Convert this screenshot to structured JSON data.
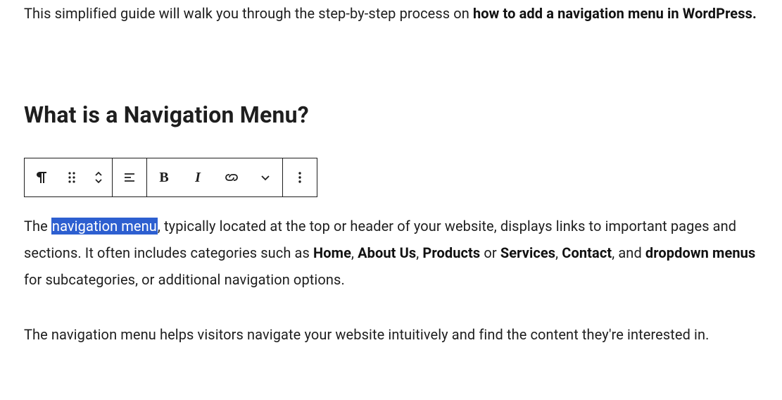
{
  "intro": {
    "prefix": "This simplified guide will walk you through the step-by-step process on ",
    "bold": "how to add a navigation menu in WordPress.",
    "suffix": ""
  },
  "heading": "What is a Navigation Menu?",
  "toolbar_icons": {
    "paragraph": "paragraph-icon",
    "drag": "drag-icon",
    "move": "move-updown-icon",
    "align": "align-left-icon",
    "bold": "B",
    "italic": "I",
    "link": "link-icon",
    "dropdown": "chevron-down-icon",
    "more": "more-vertical-icon"
  },
  "para1": {
    "t1": "The ",
    "highlight": "navigation menu",
    "t2": ", typically located at the top or header of your website, displays links to important pages and sections. It often includes categories such as ",
    "b1": "Home",
    "t3": ", ",
    "b2": "About Us",
    "t4": ", ",
    "b3": "Products",
    "t5": " or ",
    "b4": "Services",
    "t6": ", ",
    "b5": "Contact",
    "t7": ", and ",
    "b6": "dropdown menus",
    "t8": " for subcategories, or additional navigation options."
  },
  "para2": "The navigation menu helps visitors navigate your website intuitively and find the content they're interested in."
}
